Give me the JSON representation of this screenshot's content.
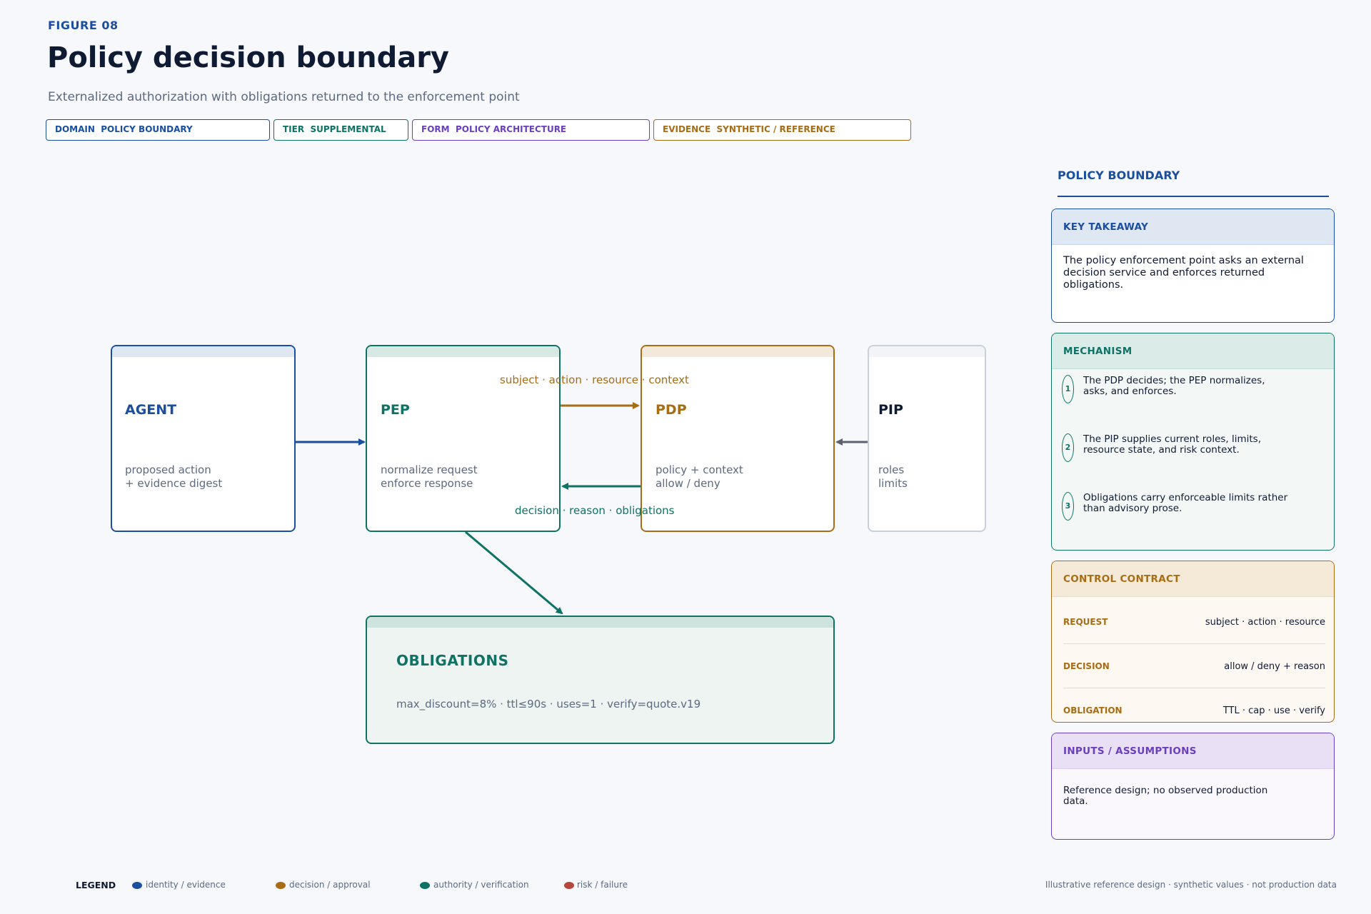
{
  "figure_label": "FIGURE 08",
  "title": "Policy decision boundary",
  "subtitle": "Externalized authorization with obligations returned to the enforcement point",
  "tags": [
    {
      "key": "DOMAIN",
      "value": "POLICY BOUNDARY",
      "color": "#1a4fa0"
    },
    {
      "key": "TIER",
      "value": "SUPPLEMENTAL",
      "color": "#0e7265"
    },
    {
      "key": "FORM",
      "value": "POLICY ARCHITECTURE",
      "color": "#6a3fbe"
    },
    {
      "key": "EVIDENCE",
      "value": "SYNTHETIC / REFERENCE",
      "color": "#a86c14"
    }
  ],
  "nodes": {
    "agent": {
      "title": "AGENT",
      "line1": "proposed action",
      "line2": "+ evidence digest",
      "color": "#1a4fa0"
    },
    "pep": {
      "title": "PEP",
      "line1": "normalize request",
      "line2": "enforce response",
      "color": "#0e7265"
    },
    "pdp": {
      "title": "PDP",
      "line1": "policy + context",
      "line2": "allow / deny",
      "color": "#a86c14"
    },
    "pip": {
      "title": "PIP",
      "line1": "roles",
      "line2": "limits",
      "color": "#c8d0dc"
    },
    "obligations": {
      "title": "OBLIGATIONS",
      "body": "max_discount=8% · ttl≤90s · uses=1 · verify=quote.v19",
      "color": "#0e7265"
    }
  },
  "edges": {
    "request_label": "subject · action · resource · context",
    "response_label": "decision · reason · obligations"
  },
  "sidebar": {
    "heading": "POLICY BOUNDARY",
    "key_takeaway": {
      "title": "KEY TAKEAWAY",
      "text": "The policy enforcement point asks an external decision service and enforces returned obligations."
    },
    "mechanism": {
      "title": "MECHANISM",
      "steps": [
        {
          "n": "1",
          "text": "The PDP decides; the PEP normalizes, asks, and enforces."
        },
        {
          "n": "2",
          "text": "The PIP supplies current roles, limits, resource state, and risk context."
        },
        {
          "n": "3",
          "text": "Obligations carry enforceable limits rather than advisory prose."
        }
      ]
    },
    "control_contract": {
      "title": "CONTROL CONTRACT",
      "rows": [
        {
          "key": "REQUEST",
          "value": "subject · action · resource"
        },
        {
          "key": "DECISION",
          "value": "allow / deny + reason"
        },
        {
          "key": "OBLIGATION",
          "value": "TTL · cap · use · verify"
        }
      ]
    },
    "inputs": {
      "title": "INPUTS / ASSUMPTIONS",
      "text": "Reference design; no observed production data."
    }
  },
  "legend": {
    "title": "LEGEND",
    "items": [
      {
        "label": "identity / evidence",
        "color": "#1a4fa0"
      },
      {
        "label": "decision / approval",
        "color": "#a86c14"
      },
      {
        "label": "authority / verification",
        "color": "#0e7265"
      },
      {
        "label": "risk / failure",
        "color": "#b5473a"
      }
    ]
  },
  "footnote": "Illustrative reference design · synthetic values · not production data"
}
